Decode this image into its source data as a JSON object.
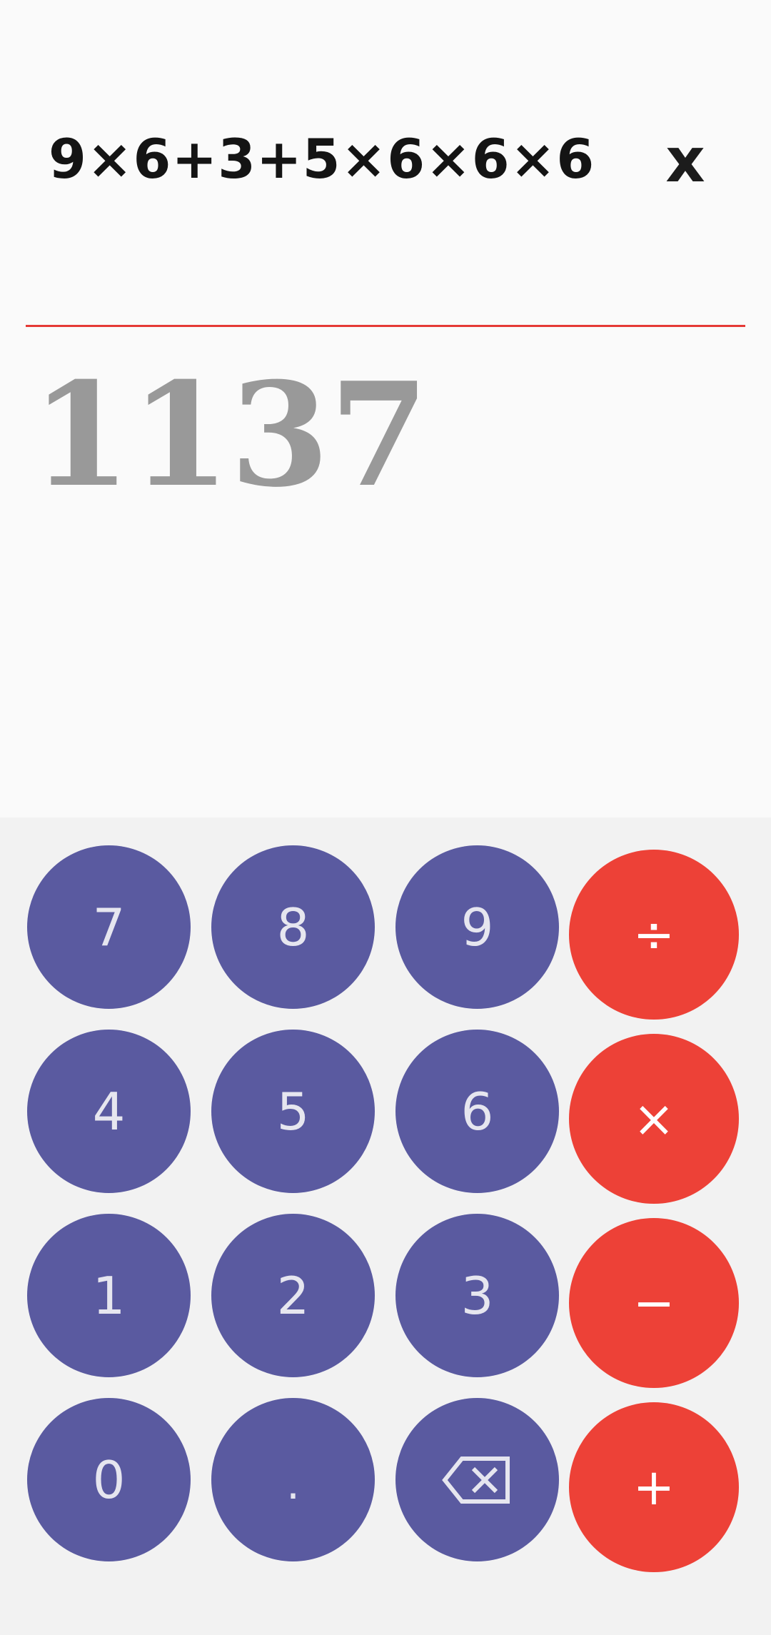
{
  "display": {
    "expression": "9×6+3+5×6×6×6",
    "clear_label": "x",
    "result": "1137"
  },
  "keypad": {
    "digits": {
      "seven": "7",
      "eight": "8",
      "nine": "9",
      "four": "4",
      "five": "5",
      "six": "6",
      "one": "1",
      "two": "2",
      "three": "3",
      "zero": "0",
      "dot": "."
    },
    "backspace_icon": "backspace-icon",
    "operators": {
      "divide": "÷",
      "multiply": "×",
      "subtract": "−",
      "add": "+"
    }
  },
  "colors": {
    "number_key": "#5a5aa0",
    "operator_key": "#ed4137",
    "divider": "#e53935",
    "result_text": "#999999"
  }
}
